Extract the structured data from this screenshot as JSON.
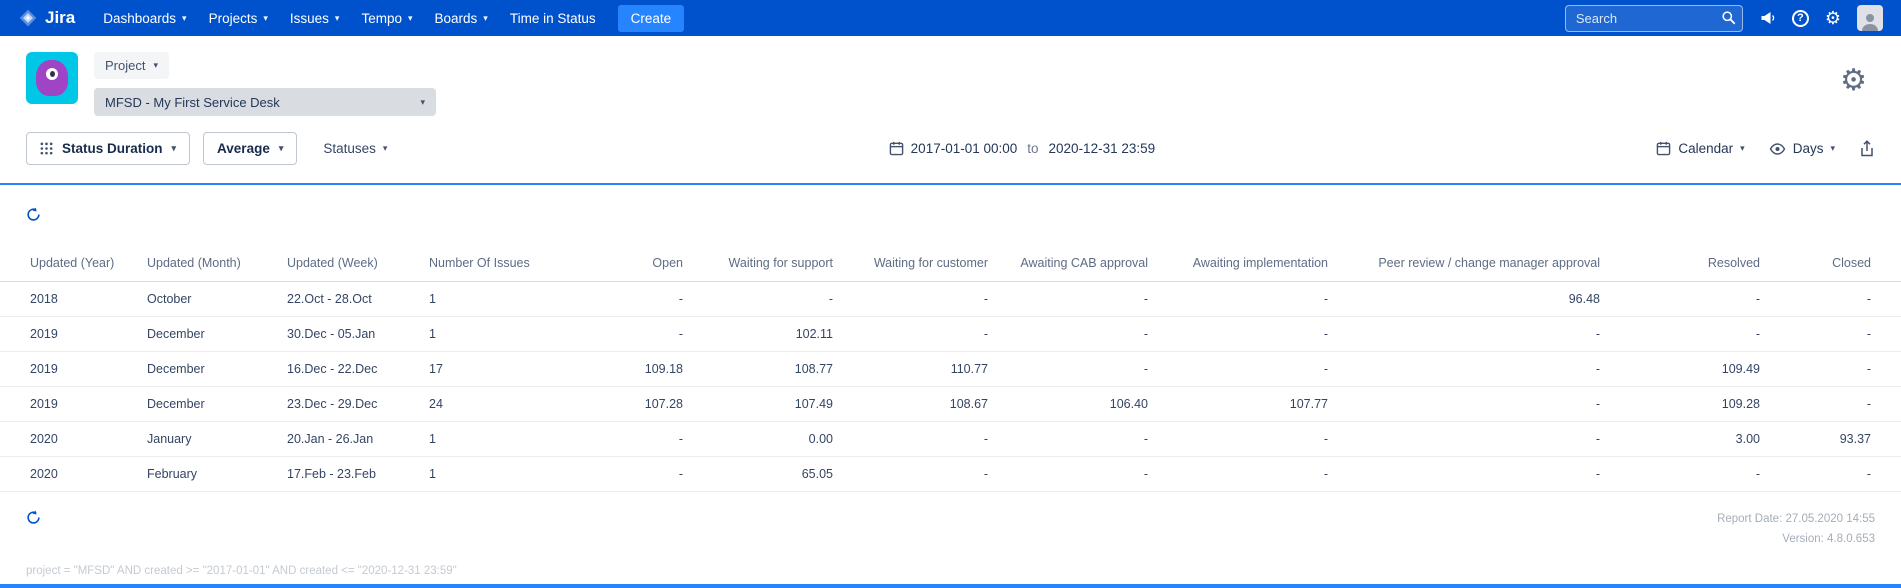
{
  "colors": {
    "navbar": "#0052CC",
    "accent": "#2684FF"
  },
  "navbar": {
    "brand": "Jira",
    "items": [
      {
        "label": "Dashboards"
      },
      {
        "label": "Projects"
      },
      {
        "label": "Issues"
      },
      {
        "label": "Tempo"
      },
      {
        "label": "Boards"
      },
      {
        "label": "Time in Status"
      }
    ],
    "create_label": "Create",
    "search_placeholder": "Search"
  },
  "header": {
    "project_button_label": "Project",
    "project_select_value": "MFSD - My First Service Desk"
  },
  "toolbar": {
    "report_type_label": "Status Duration",
    "aggregation_label": "Average",
    "statuses_label": "Statuses",
    "date_from": "2017-01-01 00:00",
    "date_separator": "to",
    "date_to": "2020-12-31 23:59",
    "calendar_label": "Calendar",
    "unit_label": "Days"
  },
  "table": {
    "columns": [
      "Updated (Year)",
      "Updated (Month)",
      "Updated (Week)",
      "Number Of Issues",
      "Open",
      "Waiting for support",
      "Waiting for customer",
      "Awaiting CAB approval",
      "Awaiting implementation",
      "Peer review / change manager approval",
      "Resolved",
      "Closed"
    ],
    "rows": [
      [
        "2018",
        "October",
        "22.Oct - 28.Oct",
        "1",
        "-",
        "-",
        "-",
        "-",
        "-",
        "96.48",
        "-",
        "-"
      ],
      [
        "2019",
        "December",
        "30.Dec - 05.Jan",
        "1",
        "-",
        "102.11",
        "-",
        "-",
        "-",
        "-",
        "-",
        "-"
      ],
      [
        "2019",
        "December",
        "16.Dec - 22.Dec",
        "17",
        "109.18",
        "108.77",
        "110.77",
        "-",
        "-",
        "-",
        "109.49",
        "-"
      ],
      [
        "2019",
        "December",
        "23.Dec - 29.Dec",
        "24",
        "107.28",
        "107.49",
        "108.67",
        "106.40",
        "107.77",
        "-",
        "109.28",
        "-"
      ],
      [
        "2020",
        "January",
        "20.Jan - 26.Jan",
        "1",
        "-",
        "0.00",
        "-",
        "-",
        "-",
        "-",
        "3.00",
        "93.37"
      ],
      [
        "2020",
        "February",
        "17.Feb - 23.Feb",
        "1",
        "-",
        "65.05",
        "-",
        "-",
        "-",
        "-",
        "-",
        "-"
      ]
    ]
  },
  "footer": {
    "report_date": "Report Date: 27.05.2020 14:55",
    "version": "Version: 4.8.0.653",
    "query": "project = \"MFSD\" AND created >= \"2017-01-01\" AND created <= \"2020-12-31 23:59\""
  },
  "icons": {
    "chevron_down": "▾",
    "gear": "⚙",
    "question": "?"
  }
}
